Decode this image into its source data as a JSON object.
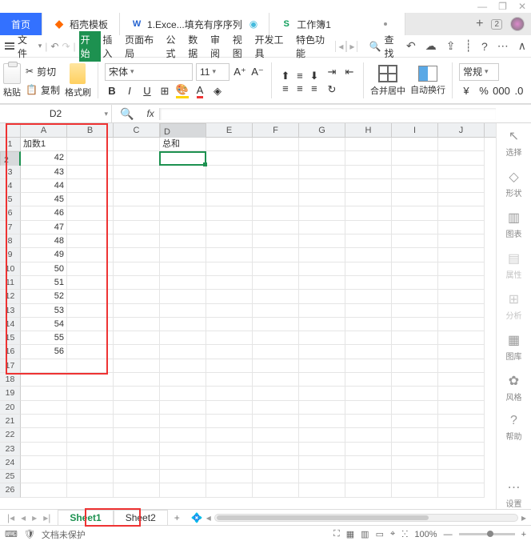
{
  "window": {
    "min": "—",
    "restore": "❐",
    "close": "✕"
  },
  "tabs": {
    "home": "首页",
    "daoke": "稻壳模板",
    "excel": "1.Exce...填充有序序列",
    "workbook": "工作簿1",
    "plus": "+",
    "badge": "2"
  },
  "menu": {
    "file": "文件",
    "items": [
      "开始",
      "插入",
      "页面布局",
      "公式",
      "数据",
      "审阅",
      "视图",
      "开发工具",
      "特色功能"
    ],
    "search_label": "查找",
    "right_icons": [
      "↶",
      "☁",
      "⇪",
      "┊",
      "?",
      "⋯",
      "∧"
    ]
  },
  "ribbon": {
    "cut": "剪切",
    "paste": "粘贴",
    "copy": "复制",
    "format_paint": "格式刷",
    "font_name": "宋体",
    "font_size": "11",
    "merge": "合并居中",
    "wrap": "自动换行",
    "general": "常规",
    "yen": "¥"
  },
  "nameBox": "D2",
  "columns": [
    "A",
    "B",
    "C",
    "D",
    "E",
    "F",
    "G",
    "H",
    "I",
    "J"
  ],
  "rows": 26,
  "cells": {
    "A1": "加数1",
    "D1": "总和",
    "A2": "42",
    "A3": "43",
    "A4": "44",
    "A5": "45",
    "A6": "46",
    "A7": "47",
    "A8": "48",
    "A9": "49",
    "A10": "50",
    "A11": "51",
    "A12": "52",
    "A13": "53",
    "A14": "54",
    "A15": "55",
    "A16": "56"
  },
  "activeCell": "D2",
  "sidepanel": [
    "选择",
    "形状",
    "图表",
    "属性",
    "分析",
    "图库",
    "风格",
    "帮助",
    "设置"
  ],
  "sidepanel_icons": [
    "⬚",
    "◇",
    "▥",
    "▤",
    "⊞",
    "▦",
    "✿",
    "?",
    "⋯"
  ],
  "sheets": [
    "Sheet1",
    "Sheet2"
  ],
  "sheet_plus": "+",
  "status": {
    "protect": "文档未保护",
    "zoom": "100%",
    "view_icons": [
      "⛶",
      "▦",
      "▥",
      "▭",
      "⌖",
      "ⵘ"
    ],
    "minus": "—",
    "plus": "+"
  },
  "chart_data": null
}
